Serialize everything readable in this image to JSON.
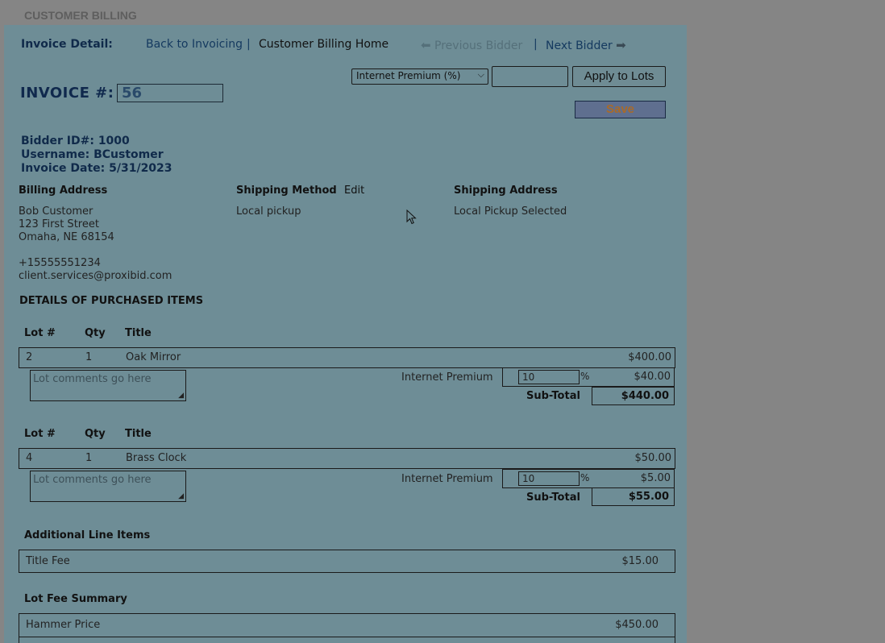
{
  "page_header": "CUSTOMER BILLING",
  "nav": {
    "title": "Invoice Detail:",
    "back": "Back to Invoicing",
    "separator": "|",
    "home": "Customer Billing Home",
    "prev": "Previous Bidder",
    "next": "Next Bidder"
  },
  "invoice": {
    "label": "INVOICE #:",
    "number": "56"
  },
  "premium_controls": {
    "select_value": "Internet Premium (%)",
    "input_value": "",
    "apply_label": "Apply to Lots",
    "save_label": "Save"
  },
  "bidder": {
    "id": "Bidder ID#: 1000",
    "username": "Username: BCustomer",
    "date": "Invoice Date: 5/31/2023"
  },
  "billing": {
    "heading": "Billing Address",
    "name": "Bob Customer",
    "street": "123 First Street",
    "city": "Omaha, NE 68154",
    "phone": "+15555551234",
    "email": "client.services@proxibid.com"
  },
  "shipping_method": {
    "heading": "Shipping Method",
    "edit": "Edit",
    "value": "Local pickup"
  },
  "shipping_address": {
    "heading": "Shipping Address",
    "value": "Local Pickup Selected"
  },
  "items_heading": "DETAILS OF PURCHASED ITEMS",
  "columns": {
    "lot": "Lot #",
    "qty": "Qty",
    "title": "Title"
  },
  "lots": [
    {
      "lot": "2",
      "qty": "1",
      "title": "Oak Mirror",
      "price": "$400.00",
      "comment_placeholder": "Lot comments go here",
      "premium_label": "Internet Premium",
      "premium_pct": "10",
      "pct_sign": "%",
      "premium_amount": "$40.00",
      "subtotal_label": "Sub-Total",
      "subtotal": "$440.00"
    },
    {
      "lot": "4",
      "qty": "1",
      "title": "Brass Clock",
      "price": "$50.00",
      "comment_placeholder": "Lot comments go here",
      "premium_label": "Internet Premium",
      "premium_pct": "10",
      "pct_sign": "%",
      "premium_amount": "$5.00",
      "subtotal_label": "Sub-Total",
      "subtotal": "$55.00"
    }
  ],
  "additional": {
    "heading": "Additional Line Items",
    "items": [
      {
        "label": "Title Fee",
        "amount": "$15.00"
      }
    ]
  },
  "fee_summary": {
    "heading": "Lot Fee Summary",
    "items": [
      {
        "label": "Hammer Price",
        "amount": "$450.00"
      }
    ]
  },
  "colors": {
    "overlay_bg": "#858585",
    "panel_bg": "#6e8d96",
    "save_text": "#a86a2a"
  }
}
